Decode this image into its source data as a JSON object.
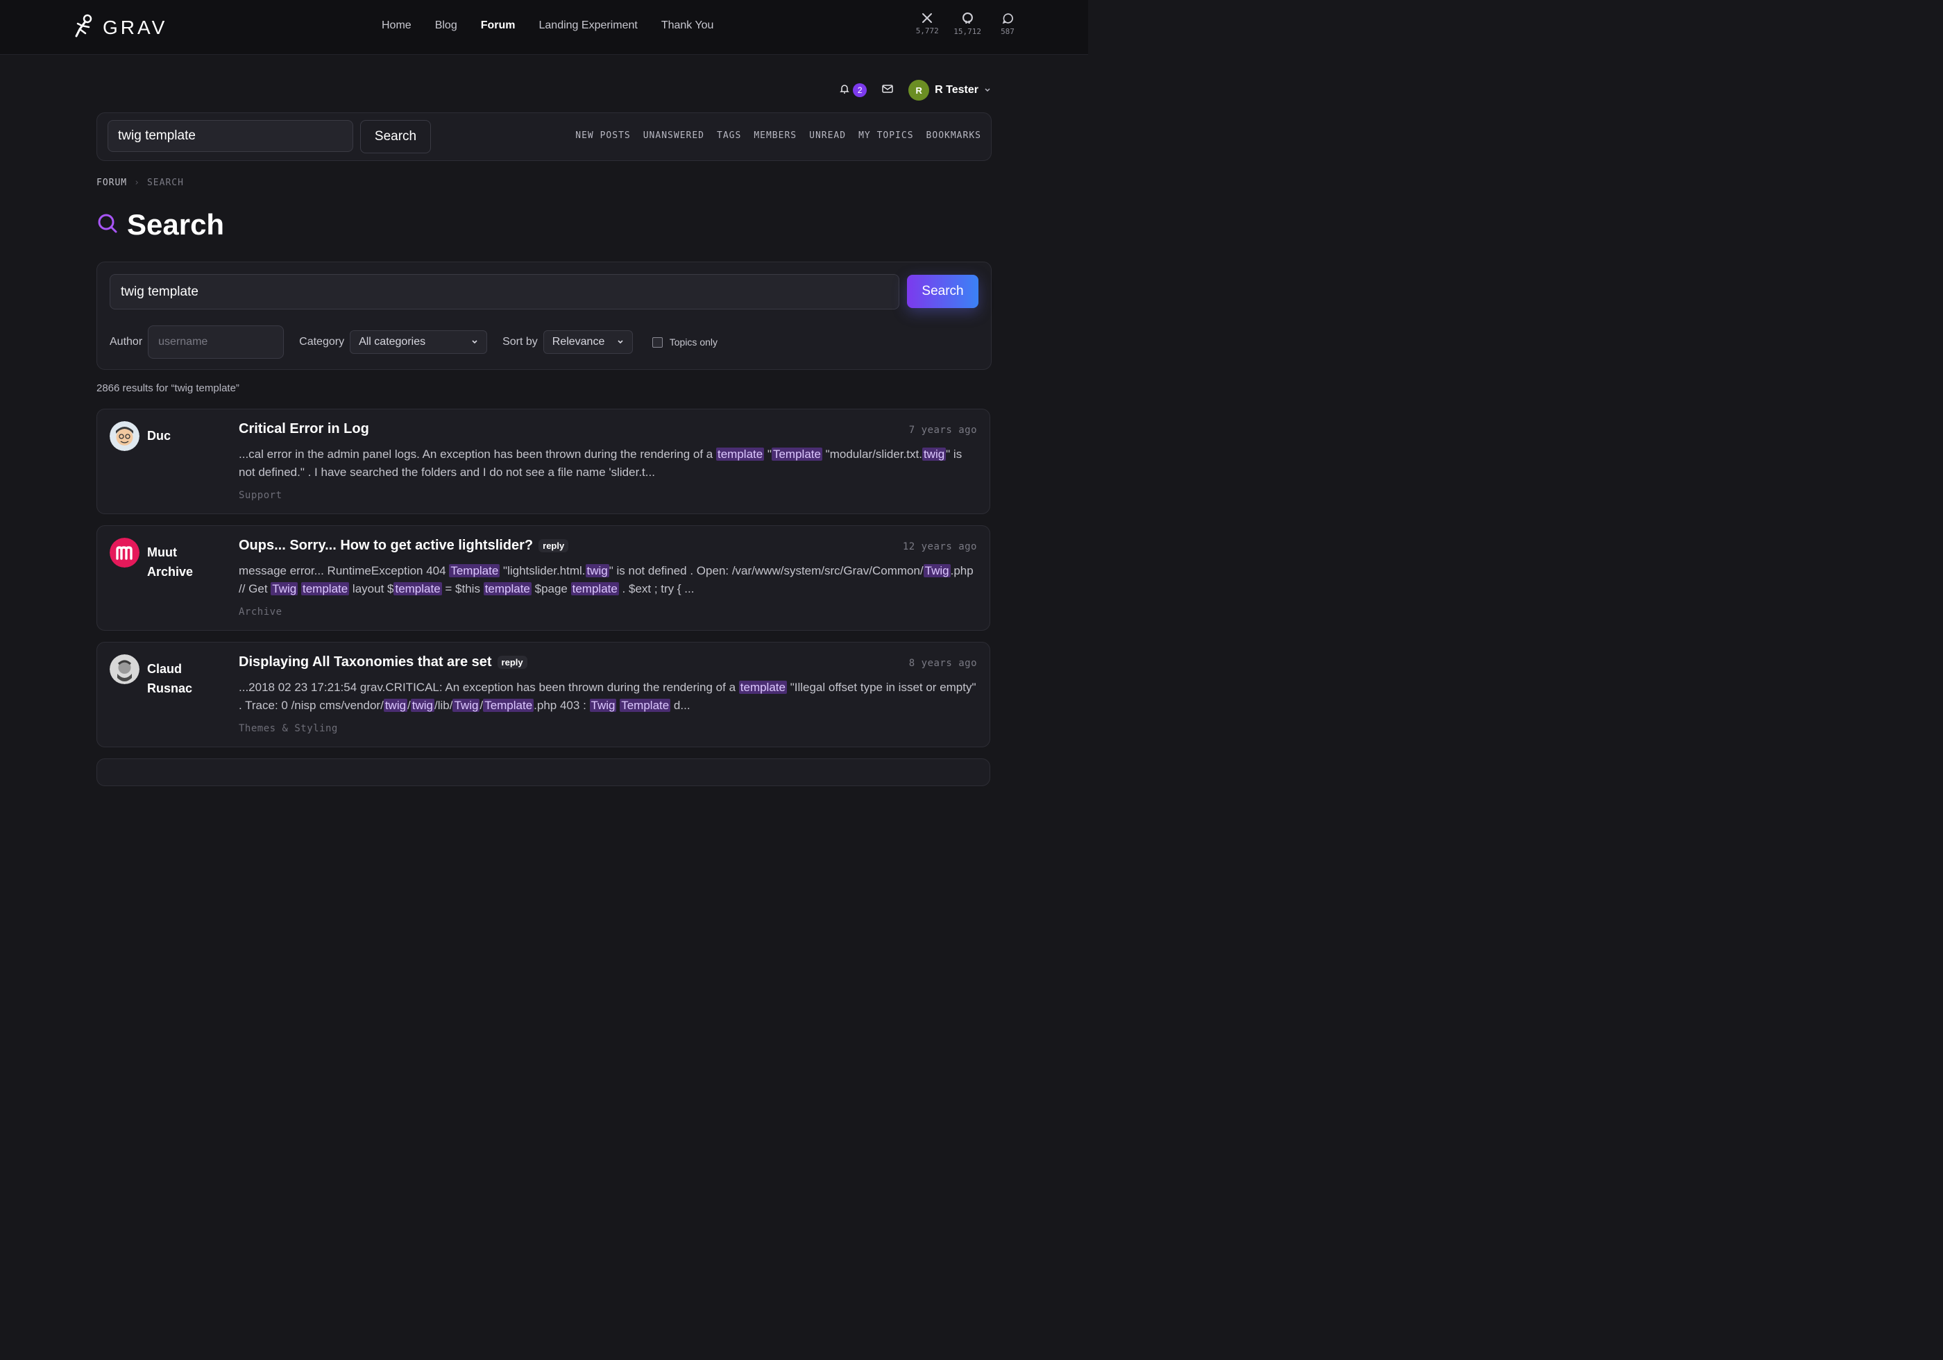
{
  "brand": {
    "name": "GRAV"
  },
  "nav": {
    "items": [
      "Home",
      "Blog",
      "Forum",
      "Landing Experiment",
      "Thank You"
    ],
    "active": "Forum"
  },
  "social": [
    {
      "icon": "x-icon",
      "count": "5,772"
    },
    {
      "icon": "github-icon",
      "count": "15,712"
    },
    {
      "icon": "chat-icon",
      "count": "587"
    }
  ],
  "user": {
    "notifications": "2",
    "initial": "R",
    "name": "R Tester"
  },
  "toolbar": {
    "search_value": "twig template",
    "search_button": "Search",
    "links": [
      "NEW POSTS",
      "UNANSWERED",
      "TAGS",
      "MEMBERS",
      "UNREAD",
      "MY TOPICS",
      "BOOKMARKS"
    ]
  },
  "breadcrumb": {
    "root": "FORUM",
    "current": "SEARCH"
  },
  "page": {
    "title": "Search"
  },
  "search_panel": {
    "query": "twig template",
    "button": "Search",
    "author_label": "Author",
    "author_placeholder": "username",
    "category_label": "Category",
    "category_value": "All categories",
    "sort_label": "Sort by",
    "sort_value": "Relevance",
    "topics_only_label": "Topics only"
  },
  "results": {
    "count_text": "2866 results for “twig template”",
    "items": [
      {
        "author": "Duc",
        "title": "Critical Error in Log",
        "reply": "",
        "time": "7 years ago",
        "excerpt": "...cal error in the admin panel logs. An exception has been thrown during the rendering of a [[template]] \"[[Template]] \"modular/slider.txt.[[twig]]\" is not defined.\" . I have searched the folders and I do not see a file name 'slider.t...",
        "category": "Support"
      },
      {
        "author": "Muut Archive",
        "title": "Oups... Sorry... How to get active lightslider?",
        "reply": "reply",
        "time": "12 years ago",
        "excerpt": "message error... RuntimeException 404 [[Template]] \"lightslider.html.[[twig]]\" is not defined . Open: /var/www/system/src/Grav/Common/[[Twig]].php // Get [[Twig]] [[template]] layout $[[template]] = $this [[template]] $page [[template]] . $ext ; try { ...",
        "category": "Archive"
      },
      {
        "author": "Claud Rusnac",
        "title": "Displaying All Taxonomies that are set",
        "reply": "reply",
        "time": "8 years ago",
        "excerpt": "...2018 02 23 17:21:54 grav.CRITICAL: An exception has been thrown during the rendering of a [[template]] \"Illegal offset type in isset or empty\" . Trace: 0 /nisp cms/vendor/[[twig]]/[[twig]]/lib/[[Twig]]/[[Template]].php 403 : [[Twig]] [[Template]] d...",
        "category": "Themes & Styling"
      }
    ]
  }
}
